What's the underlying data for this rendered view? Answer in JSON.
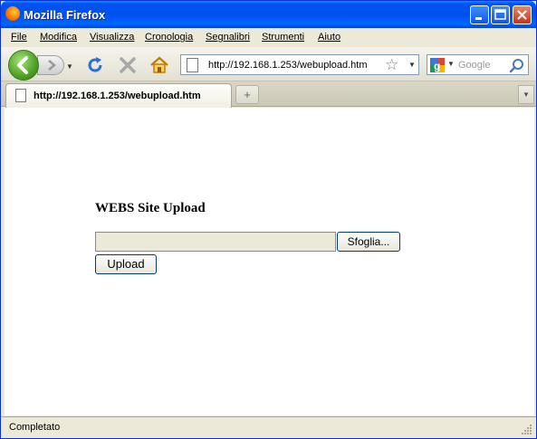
{
  "window": {
    "title": "Mozilla Firefox"
  },
  "menu": {
    "items": [
      "File",
      "Modifica",
      "Visualizza",
      "Cronologia",
      "Segnalibri",
      "Strumenti",
      "Aiuto"
    ]
  },
  "navbar": {
    "url": "http://192.168.1.253/webupload.htm",
    "search_placeholder": "Google",
    "icons": [
      "back-arrow-icon",
      "forward-arrow-icon",
      "reload-icon",
      "stop-icon",
      "home-icon",
      "page-icon",
      "bookmark-star-icon",
      "google-engine-icon",
      "magnifier-icon"
    ]
  },
  "tabs": [
    {
      "label": "http://192.168.1.253/webupload.htm",
      "active": true
    }
  ],
  "page": {
    "heading": "WEBS Site Upload",
    "file_value": "",
    "browse_label": "Sfoglia...",
    "upload_label": "Upload"
  },
  "status": {
    "text": "Completato"
  },
  "colors": {
    "titlebar": "#0053ee",
    "chrome": "#ece9d8",
    "close_button": "#c2351b",
    "back_button": "#4ea123"
  }
}
